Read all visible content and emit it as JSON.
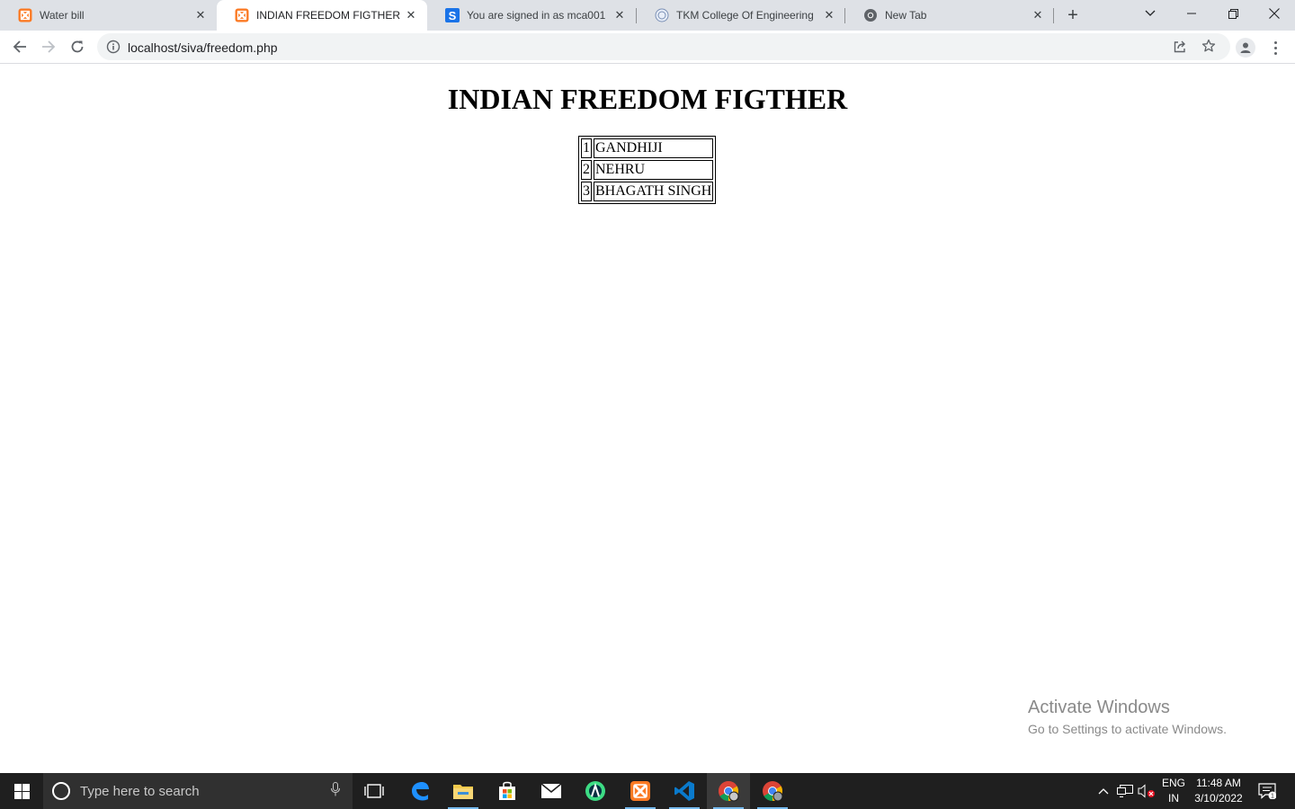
{
  "browser": {
    "tabs": [
      {
        "title": "Water bill",
        "favicon": "xampp-icon",
        "active": false
      },
      {
        "title": "INDIAN FREEDOM FIGTHER",
        "favicon": "xampp-icon",
        "active": true
      },
      {
        "title": "You are signed in as mca001",
        "favicon": "s-logo-icon",
        "active": false
      },
      {
        "title": "TKM College Of Engineering",
        "favicon": "college-seal-icon",
        "active": false
      },
      {
        "title": "New Tab",
        "favicon": "chrome-icon",
        "active": false
      }
    ],
    "address": {
      "url": "localhost/siva/freedom.php"
    }
  },
  "page": {
    "heading": "INDIAN FREEDOM FIGTHER",
    "table_rows": [
      {
        "num": "1",
        "name": "GANDHIJI"
      },
      {
        "num": "2",
        "name": "NEHRU"
      },
      {
        "num": "3",
        "name": "BHAGATH SINGH"
      }
    ]
  },
  "watermark": {
    "title": "Activate Windows",
    "subtitle": "Go to Settings to activate Windows."
  },
  "taskbar": {
    "search_placeholder": "Type here to search",
    "apps": [
      "task-view-icon",
      "edge-icon",
      "file-explorer-icon",
      "store-icon",
      "mail-icon",
      "android-studio-icon",
      "xampp-icon",
      "vscode-icon",
      "chrome-icon",
      "chrome-icon"
    ],
    "language_top": "ENG",
    "language_bottom": "IN",
    "time": "11:48 AM",
    "date": "3/10/2022",
    "notification_count": "1"
  },
  "colors": {
    "tabstrip_bg": "#dee1e6",
    "omnibox_bg": "#f1f3f4",
    "taskbar_bg": "#1f1f1f",
    "xampp_orange": "#fb7a24",
    "taskbar_running": "#76b9ed"
  }
}
